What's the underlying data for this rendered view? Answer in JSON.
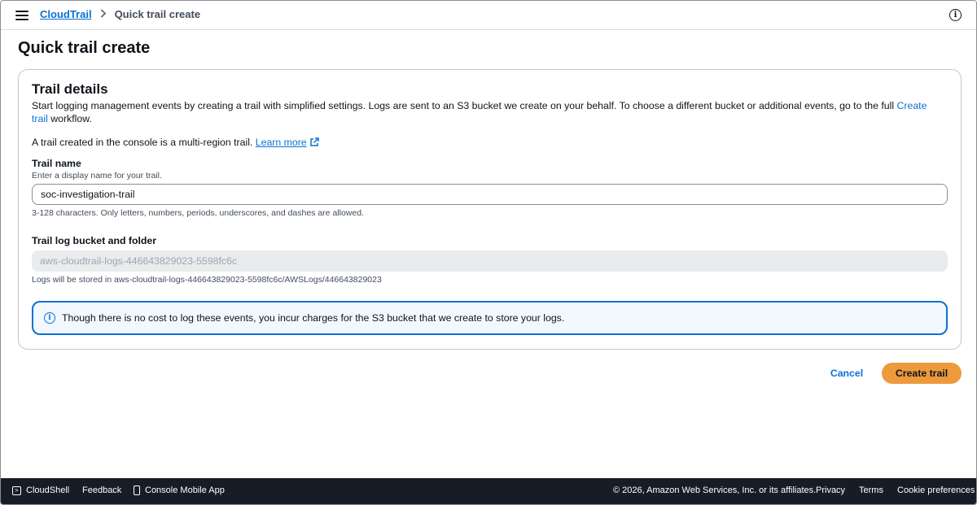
{
  "header": {
    "breadcrumb_root": "CloudTrail",
    "breadcrumb_separator": ">",
    "breadcrumb_current": "Quick trail create",
    "info_icon": "info-icon"
  },
  "page": {
    "title": "Quick trail create"
  },
  "trail_details": {
    "title": "Trail details",
    "description": "Start logging management events by creating a trail with simplified settings. Logs are sent to an S3 bucket we create on your behalf. To choose a different bucket or additional events, go to the full ",
    "description_link": "Create trail",
    "description_end": " workflow.",
    "multi_region_text": "A trail created in the console is a multi-region trail. ",
    "learn_more": "Learn more",
    "trail_name_label": "Trail name",
    "trail_name_hint": "Enter a display name for your trail.",
    "trail_name_value": "soc-investigation-trail",
    "trail_name_constraint": "3-128 characters. Only letters, numbers, periods, underscores, and dashes are allowed.",
    "bucket_label": "Trail log bucket and folder",
    "bucket_value": "aws-cloudtrail-logs-446643829023-5598fc6c",
    "bucket_note": "Logs will be stored in aws-cloudtrail-logs-446643829023-5598fc6c/AWSLogs/446643829023",
    "alert_text": "Though there is no cost to log these events, you incur charges for the S3 bucket that we create to store your logs."
  },
  "actions": {
    "cancel": "Cancel",
    "create": "Create trail"
  },
  "footer": {
    "cloudshell": "CloudShell",
    "feedback": "Feedback",
    "mobile_app": "Console Mobile App",
    "copyright": "© 2026, Amazon Web Services, Inc. or its affiliates.",
    "privacy": "Privacy",
    "terms": "Terms",
    "cookies": "Cookie preferences"
  },
  "colors": {
    "link": "#0972d3",
    "primary_button": "#ec9a3c",
    "footer_bg": "#161d26",
    "alert_bg": "#f2f8fd"
  }
}
